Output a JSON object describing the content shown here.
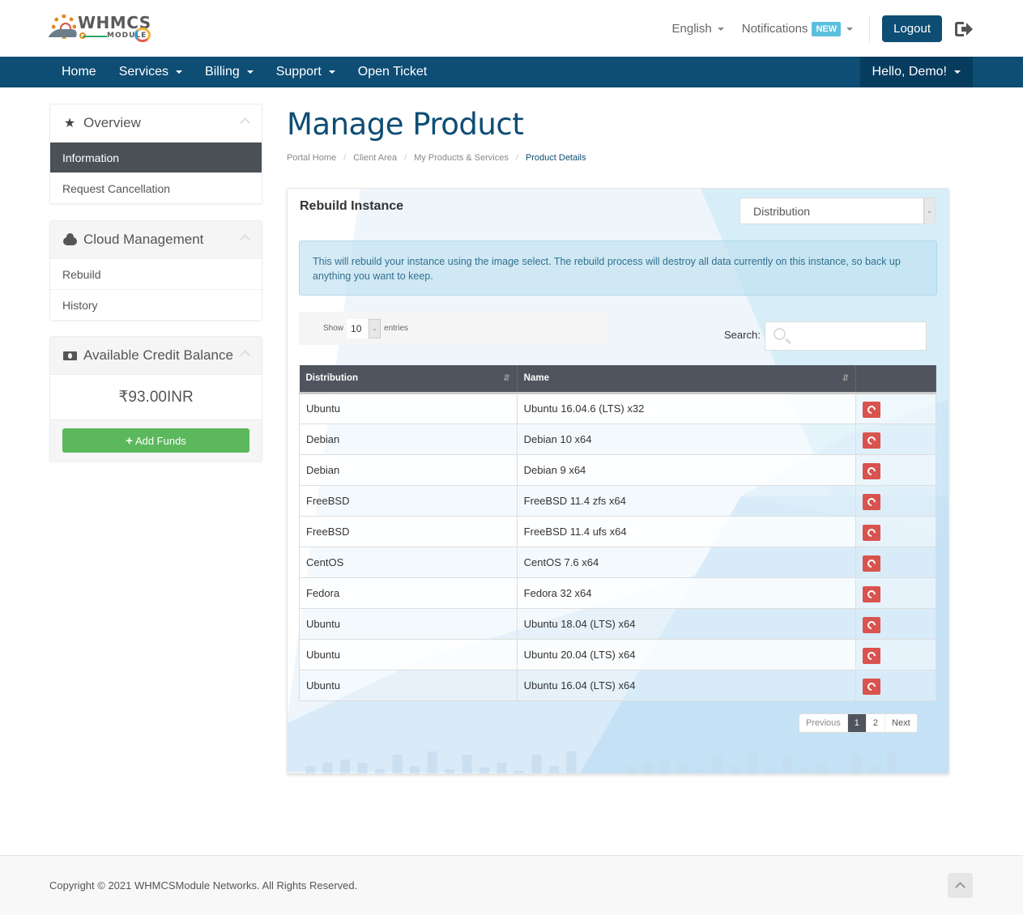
{
  "header": {
    "logo_text_main": "WHMCS",
    "logo_text_sub": "MODULE",
    "language_label": "English",
    "notifications_label": "Notifications",
    "notifications_badge": "NEW",
    "logout_label": "Logout"
  },
  "nav": {
    "items": [
      {
        "label": "Home",
        "dropdown": false
      },
      {
        "label": "Services",
        "dropdown": true
      },
      {
        "label": "Billing",
        "dropdown": true
      },
      {
        "label": "Support",
        "dropdown": true
      },
      {
        "label": "Open Ticket",
        "dropdown": false
      }
    ],
    "user_label": "Hello, Demo!"
  },
  "sidebar": {
    "overview": {
      "title": "Overview",
      "items": [
        {
          "label": "Information",
          "active": true
        },
        {
          "label": "Request Cancellation",
          "active": false
        }
      ]
    },
    "cloud": {
      "title": "Cloud Management",
      "items": [
        {
          "label": "Rebuild"
        },
        {
          "label": "History"
        }
      ]
    },
    "credit": {
      "title": "Available Credit Balance",
      "value": "₹93.00INR",
      "add_funds_label": "Add Funds"
    }
  },
  "main": {
    "page_title": "Manage Product",
    "breadcrumb": [
      "Portal Home",
      "Client Area",
      "My Products & Services",
      "Product Details"
    ],
    "card": {
      "title": "Rebuild Instance",
      "filter_select": "Distribution",
      "alert": "This will rebuild your instance using the image select. The rebuild process will destroy all data currently on this instance, so back up anything you want to keep.",
      "show_label": "Show",
      "entries_value": "10",
      "entries_label": "entries",
      "search_label": "Search:",
      "search_placeholder": "",
      "columns": [
        "Distribution",
        "Name",
        ""
      ],
      "rows": [
        {
          "distribution": "Ubuntu",
          "name": "Ubuntu 16.04.6 (LTS) x32"
        },
        {
          "distribution": "Debian",
          "name": "Debian 10 x64"
        },
        {
          "distribution": "Debian",
          "name": "Debian 9 x64"
        },
        {
          "distribution": "FreeBSD",
          "name": "FreeBSD 11.4 zfs x64"
        },
        {
          "distribution": "FreeBSD",
          "name": "FreeBSD 11.4 ufs x64"
        },
        {
          "distribution": "CentOS",
          "name": "CentOS 7.6 x64"
        },
        {
          "distribution": "Fedora",
          "name": "Fedora 32 x64"
        },
        {
          "distribution": "Ubuntu",
          "name": "Ubuntu 18.04 (LTS) x64"
        },
        {
          "distribution": "Ubuntu",
          "name": "Ubuntu 20.04 (LTS) x64"
        },
        {
          "distribution": "Ubuntu",
          "name": "Ubuntu 16.04 (LTS) x64"
        }
      ],
      "pagination": {
        "previous": "Previous",
        "pages": [
          "1",
          "2"
        ],
        "current": "1",
        "next": "Next"
      }
    }
  },
  "footer": {
    "copyright": "Copyright © 2021 WHMCSModule Networks. All Rights Reserved."
  },
  "colors": {
    "brand": "#0e4d74",
    "success": "#5cb85c",
    "danger": "#d9534f",
    "info_badge": "#5bc0de",
    "table_header": "#4f545e"
  }
}
